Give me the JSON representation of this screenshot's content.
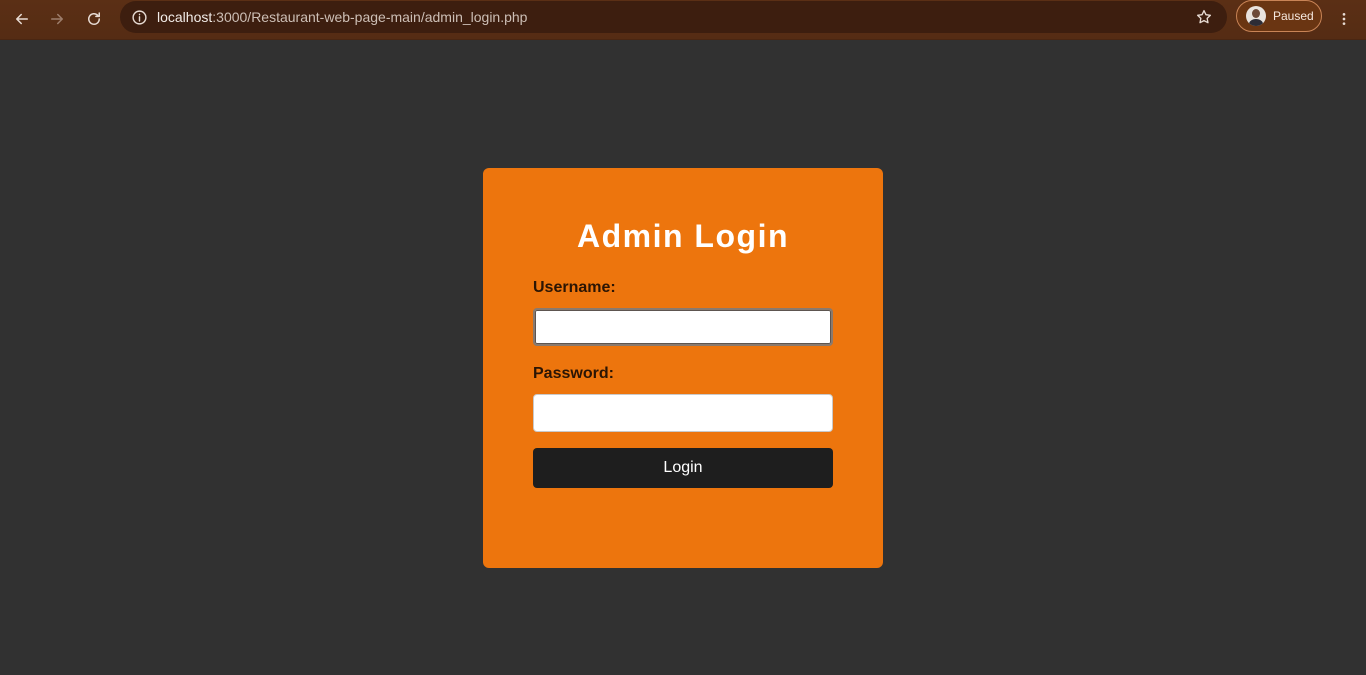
{
  "browser": {
    "url_host": "localhost",
    "url_rest": ":3000/Restaurant-web-page-main/admin_login.php",
    "profile_label": "Paused",
    "icons": {
      "back": "arrow-left-icon",
      "forward": "arrow-right-icon",
      "reload": "reload-icon",
      "site_info": "info-icon",
      "bookmark": "star-icon",
      "menu": "kebab-menu-icon"
    }
  },
  "login": {
    "title": "Admin Login",
    "username_label": "Username:",
    "username_value": "",
    "password_label": "Password:",
    "password_value": "",
    "button_label": "Login"
  },
  "colors": {
    "page_background": "#313131",
    "card_background": "#ed750d",
    "button_background": "#1e1e1e",
    "toolbar_background": "#5a2f16"
  }
}
